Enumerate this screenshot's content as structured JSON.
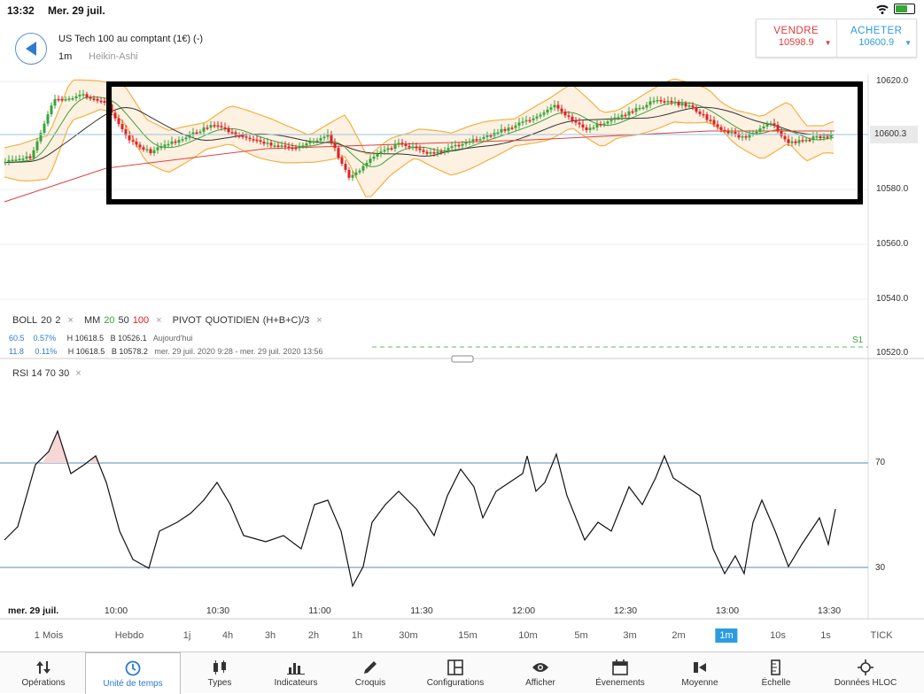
{
  "status": {
    "time": "13:32",
    "date": "Mer. 29 juil."
  },
  "header": {
    "instrument": "US Tech 100 au comptant (1€) (-)",
    "timeframe": "1m",
    "chart_type": "Heikin-Ashi"
  },
  "quotes": {
    "sell_label": "VENDRE",
    "sell_value": "10598.9",
    "buy_label": "ACHETER",
    "buy_value": "10600.9"
  },
  "price_axis": [
    "10620.0",
    "10600.3",
    "10580.0",
    "10560.0",
    "10540.0",
    "10520.0"
  ],
  "indicators": {
    "boll": [
      "BOLL",
      "20",
      "2"
    ],
    "mm": [
      "MM",
      "20",
      "50",
      "100"
    ],
    "pivot": [
      "PIVOT",
      "QUOTIDIEN",
      "(H+B+C)/3"
    ],
    "close": "×"
  },
  "stats": [
    {
      "a": "60.5",
      "b": "0.57%",
      "h": "H 10618.5",
      "l": "B 10526.1",
      "p": "Aujourd'hui"
    },
    {
      "a": "11.8",
      "b": "0.11%",
      "h": "H 10618.5",
      "l": "B 10578.2",
      "p": "mer. 29 juil. 2020 9:28 - mer. 29 juil. 2020 13:56"
    }
  ],
  "s1": "S1",
  "rsi": {
    "label": "RSI  14  70  30",
    "levels": [
      "70",
      "30"
    ]
  },
  "time_axis": {
    "date": "mer. 29 juil.",
    "ticks": [
      "10:00",
      "10:30",
      "11:00",
      "11:30",
      "12:00",
      "12:30",
      "13:00",
      "13:30"
    ]
  },
  "scales": [
    "1 Mois",
    "Hebdo",
    "1j",
    "4h",
    "3h",
    "2h",
    "1h",
    "30m",
    "15m",
    "10m",
    "5m",
    "3m",
    "2m",
    "1m",
    "10s",
    "1s",
    "TICK"
  ],
  "selected_scale": "1m",
  "toolbar": [
    "Opérations",
    "Unité de temps",
    "Types",
    "Indicateurs",
    "Croquis",
    "Configurations",
    "Afficher",
    "Évenements",
    "Moyenne",
    "Échelle",
    "Données HLOC"
  ],
  "colors": {
    "up": "#3aa33a",
    "down": "#e02020",
    "accent": "#2c9be0",
    "band": "#f5b042"
  }
}
